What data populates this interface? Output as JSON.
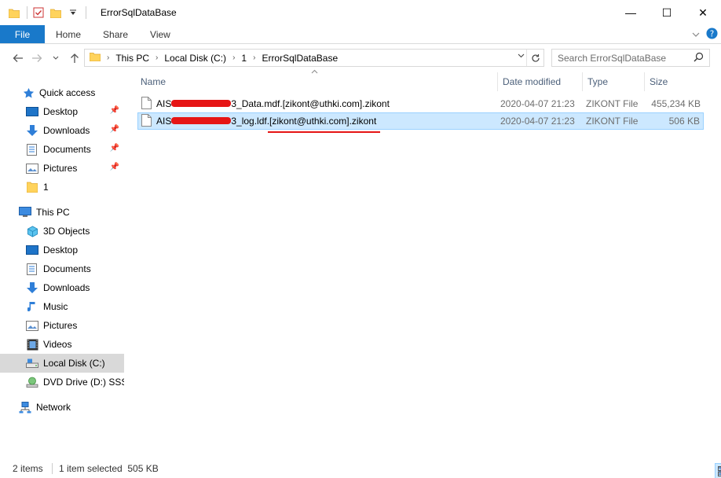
{
  "window": {
    "title": "ErrorSqlDataBase",
    "controls": {
      "minimize": "—",
      "maximize": "☐",
      "close": "✕"
    }
  },
  "ribbon": {
    "tabs": [
      "File",
      "Home",
      "Share",
      "View"
    ]
  },
  "address": {
    "crumbs": [
      "This PC",
      "Local Disk (C:)",
      "1",
      "ErrorSqlDataBase"
    ]
  },
  "search": {
    "placeholder": "Search ErrorSqlDataBase"
  },
  "nav": {
    "quick_access": "Quick access",
    "quick_items": [
      "Desktop",
      "Downloads",
      "Documents",
      "Pictures",
      "1"
    ],
    "this_pc": "This PC",
    "pc_items": [
      "3D Objects",
      "Desktop",
      "Documents",
      "Downloads",
      "Music",
      "Pictures",
      "Videos",
      "Local Disk (C:)",
      "DVD Drive (D:) SSS_X"
    ],
    "network": "Network"
  },
  "columns": {
    "name": "Name",
    "date": "Date modified",
    "type": "Type",
    "size": "Size"
  },
  "files": [
    {
      "name_prefix": "AIS",
      "name_suffix": "3_Data.mdf.[zikont@uthki.com].zikont",
      "date": "2020-04-07 21:23",
      "type": "ZIKONT File",
      "size": "455,234 KB",
      "selected": false
    },
    {
      "name_prefix": "AIS",
      "name_suffix": "3_log.ldf.[zikont@uthki.com].zikont",
      "date": "2020-04-07 21:23",
      "type": "ZIKONT File",
      "size": "506 KB",
      "selected": true
    }
  ],
  "status": {
    "items": "2 items",
    "selected": "1 item selected  505 KB"
  },
  "colors": {
    "accent": "#1979ca",
    "selection": "#cce8ff",
    "redaction": "#e61515"
  }
}
